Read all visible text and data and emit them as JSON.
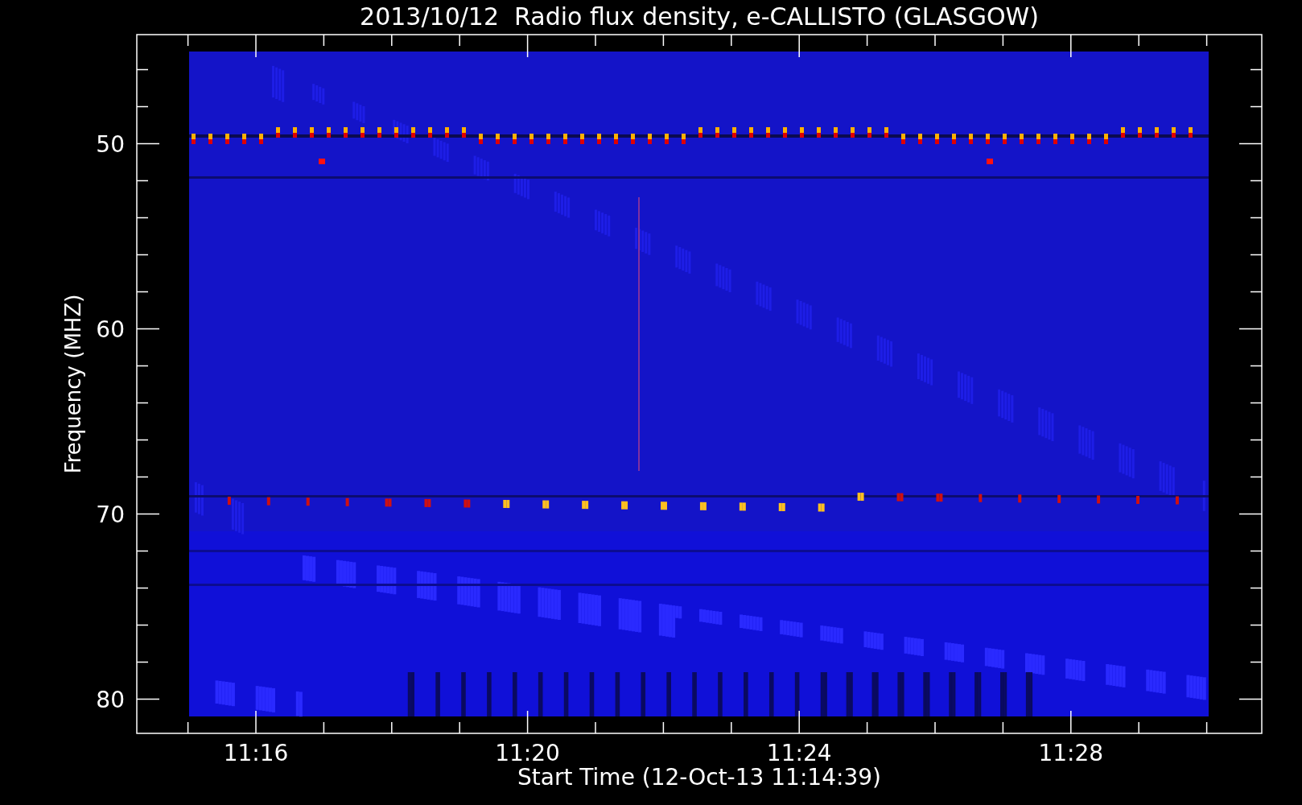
{
  "title": "2013/10/12  Radio flux density, e-CALLISTO (GLASGOW)",
  "plot": {
    "ylabel": "Frequency (MHZ)",
    "xlabel": "Start Time (12-Oct-13 11:14:39)",
    "yticks": [
      "50",
      "60",
      "70",
      "80"
    ],
    "xticks": [
      "11:16",
      "11:20",
      "11:24",
      "11:28"
    ]
  }
}
